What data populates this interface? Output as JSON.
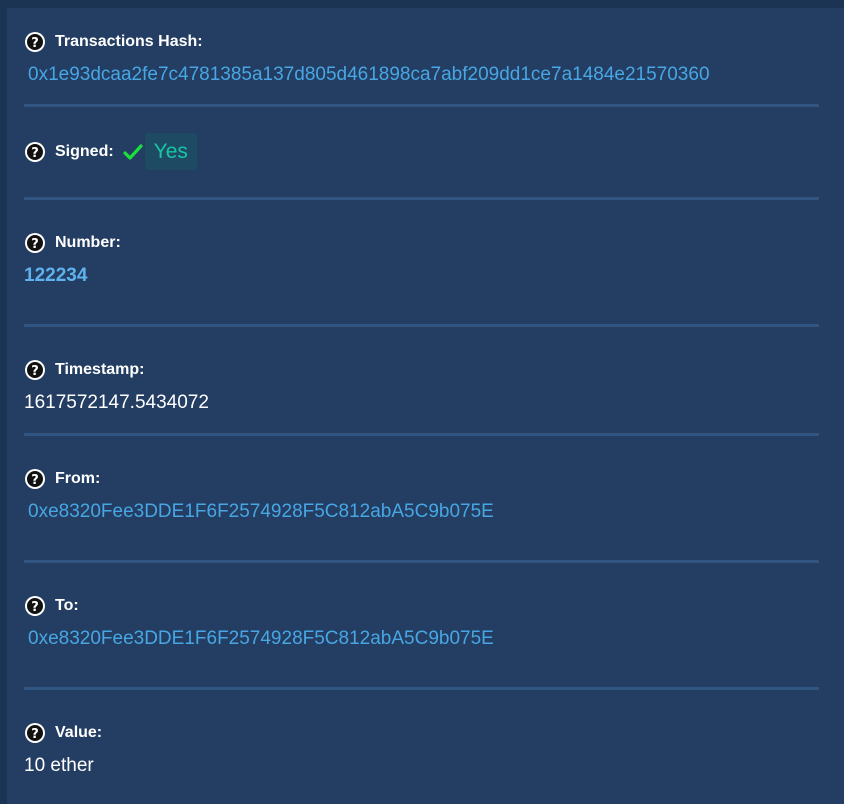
{
  "fields": {
    "hash": {
      "label": "Transactions Hash:",
      "value": "0x1e93dcaa2fe7c4781385a137d805d461898ca7abf209dd1ce7a1484e21570360"
    },
    "signed": {
      "label": "Signed:",
      "value": "Yes"
    },
    "number": {
      "label": "Number:",
      "value": "122234"
    },
    "timestamp": {
      "label": "Timestamp:",
      "value": "1617572147.5434072"
    },
    "from": {
      "label": "From:",
      "value": "0xe8320Fee3DDE1F6F2574928F5C812abA5C9b075E"
    },
    "to": {
      "label": "To:",
      "value": "0xe8320Fee3DDE1F6F2574928F5C812abA5C9b075E"
    },
    "value": {
      "label": "Value:",
      "value": "10 ether"
    }
  },
  "icons": {
    "help": "question-circle-icon",
    "signed": "checkmark-icon"
  },
  "colors": {
    "background": "#233e62",
    "link": "#48a6e4",
    "badge_text": "#16c6a4",
    "check": "#19e03a"
  }
}
